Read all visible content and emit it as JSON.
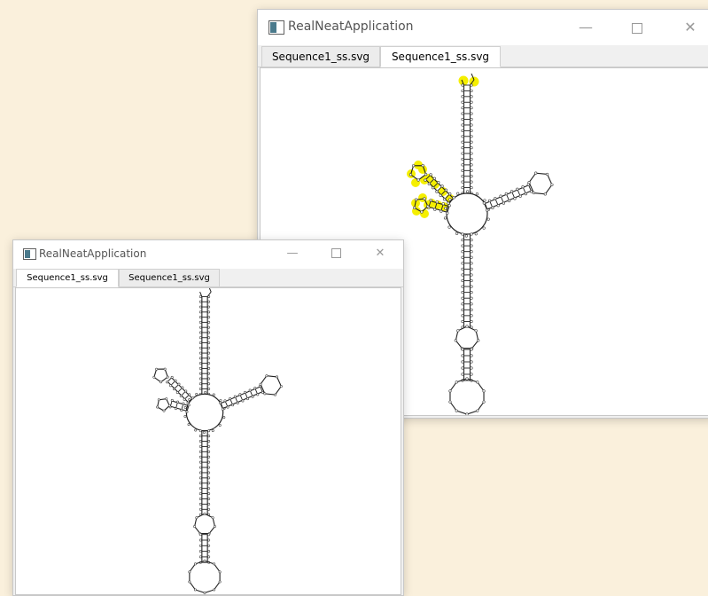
{
  "desktop": {
    "background": "#faf0dc"
  },
  "windows": [
    {
      "title": "RealNeatApplication",
      "tabs": [
        {
          "label": "Sequence1_ss.svg",
          "active": false
        },
        {
          "label": "Sequence1_ss.svg",
          "active": true
        }
      ],
      "highlight_color": "#f5ef00"
    },
    {
      "title": "RealNeatApplication",
      "tabs": [
        {
          "label": "Sequence1_ss.svg",
          "active": true
        },
        {
          "label": "Sequence1_ss.svg",
          "active": false
        }
      ]
    }
  ],
  "caption_icons": {
    "minimize": "minimize-icon",
    "maximize": "maximize-icon",
    "close": "close-icon"
  },
  "caption_glyphs": {
    "minimize": "—",
    "close": "✕"
  }
}
